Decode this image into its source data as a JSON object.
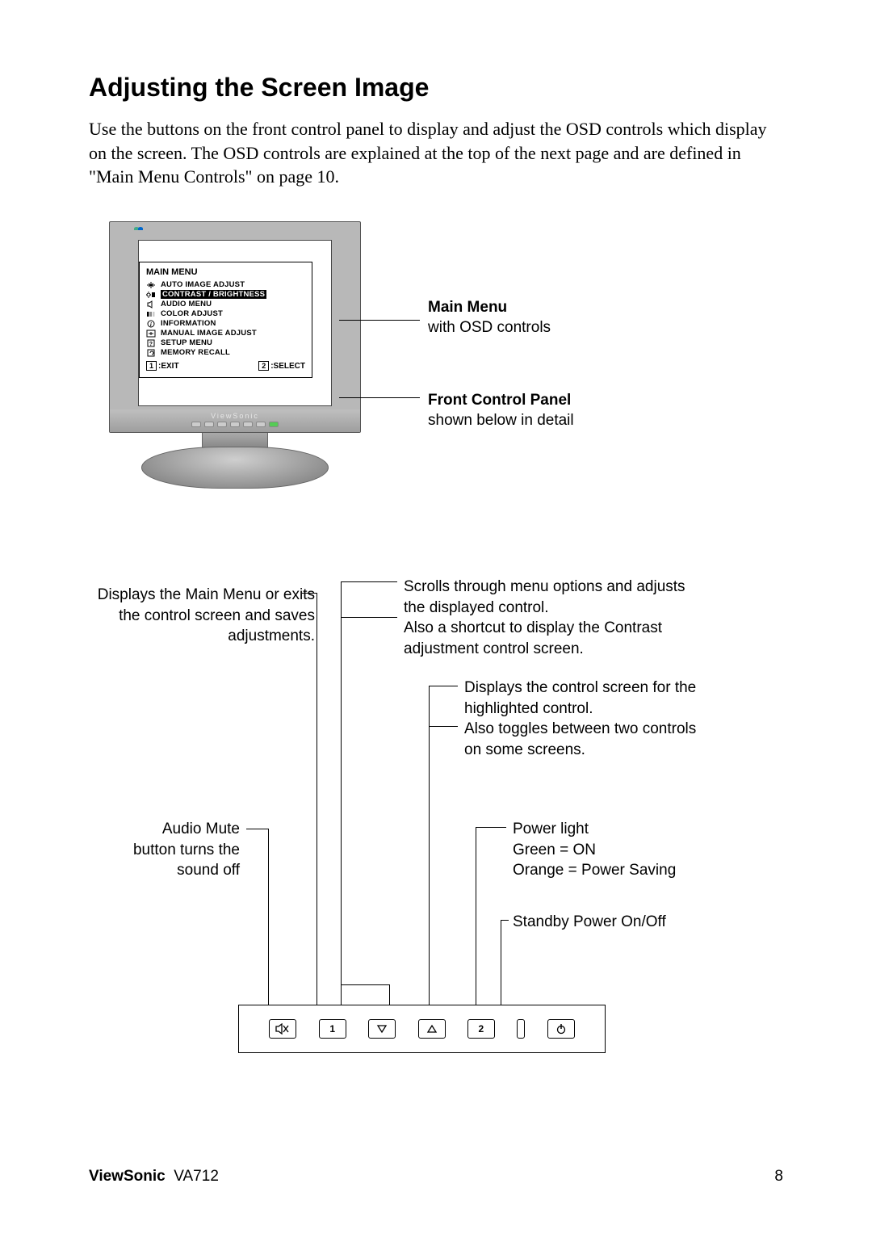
{
  "title": "Adjusting the Screen Image",
  "intro": "Use the buttons on the front control panel to display and adjust the OSD controls which display on the screen. The OSD controls are explained at the top of the next page and are defined in \"Main Menu Controls\" on page 10.",
  "osd": {
    "title": "MAIN MENU",
    "items": [
      "AUTO IMAGE ADJUST",
      "CONTRAST / BRIGHTNESS",
      "AUDIO MENU",
      "COLOR ADJUST",
      "INFORMATION",
      "MANUAL IMAGE ADJUST",
      "SETUP MENU",
      "MEMORY RECALL"
    ],
    "exit_key": "1",
    "exit_label": ":EXIT",
    "select_key": "2",
    "select_label": ":SELECT"
  },
  "upper_callouts": {
    "main_menu_title": "Main Menu",
    "main_menu_sub": "with OSD controls",
    "front_panel_title": "Front Control Panel",
    "front_panel_sub": "shown below in detail"
  },
  "lower": {
    "btn1": "Displays the Main Menu or exits the control screen and saves adjustments.",
    "arrows_a": "Scrolls through menu options and adjusts the displayed control.",
    "arrows_b": "Also a shortcut to display the Contrast adjustment control screen.",
    "btn2_a": "Displays the control screen for the highlighted control.",
    "btn2_b": "Also toggles between two controls on some screens.",
    "mute": "Audio Mute button turns the sound off",
    "pled_a": "Power light",
    "pled_b": "Green = ON",
    "pled_c": "Orange = Power Saving",
    "power": "Standby Power On/Off"
  },
  "panel_buttons": {
    "b1": "1",
    "b2": "2"
  },
  "footer": {
    "brand": "ViewSonic",
    "model": "VA712",
    "page": "8"
  }
}
